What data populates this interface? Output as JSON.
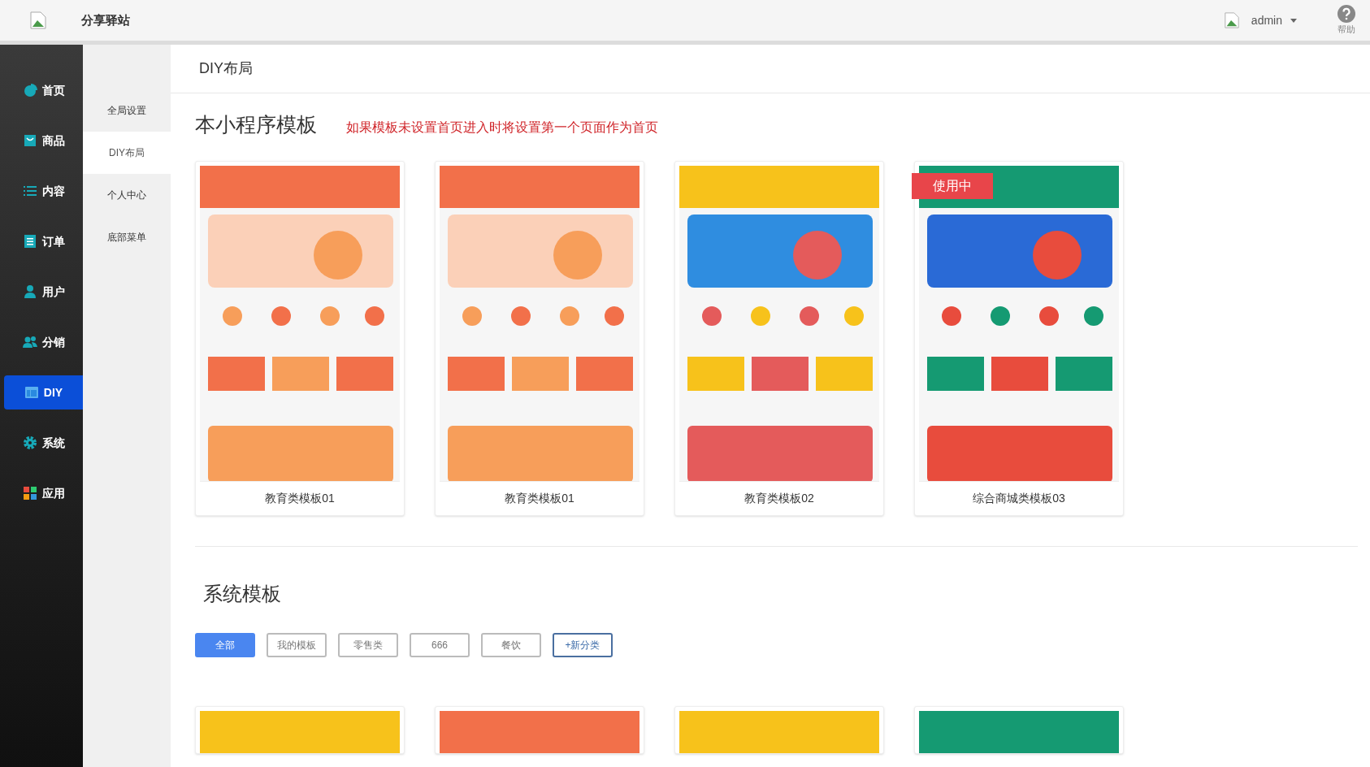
{
  "header": {
    "site_name": "分享驿站",
    "user": "admin",
    "help": "帮助"
  },
  "nav": [
    {
      "label": "首页",
      "selected": false
    },
    {
      "label": "商品",
      "selected": false
    },
    {
      "label": "内容",
      "selected": false
    },
    {
      "label": "订单",
      "selected": false
    },
    {
      "label": "用户",
      "selected": false
    },
    {
      "label": "分销",
      "selected": false
    },
    {
      "label": "DIY",
      "selected": true
    },
    {
      "label": "系统",
      "selected": false
    },
    {
      "label": "应用",
      "selected": false
    }
  ],
  "subnav": [
    {
      "label": "全局设置",
      "selected": false
    },
    {
      "label": "DIY布局",
      "selected": true
    },
    {
      "label": "个人中心",
      "selected": false
    },
    {
      "label": "底部菜单",
      "selected": false
    }
  ],
  "page_title": "DIY布局",
  "my_templates": {
    "title": "本小程序模板",
    "notice": "如果模板未设置首页进入时将设置第一个页面作为首页",
    "items": [
      {
        "caption": "教育类模板01"
      },
      {
        "caption": "教育类模板01"
      },
      {
        "caption": "教育类模板02"
      },
      {
        "caption": "综合商城类模板03",
        "badge": "使用中"
      }
    ]
  },
  "system_templates": {
    "title": "系统模板",
    "filters": [
      {
        "label": "全部",
        "kind": "category",
        "selected": true
      },
      {
        "label": "我的模板",
        "kind": "category",
        "selected": false
      },
      {
        "label": "零售类",
        "kind": "category",
        "selected": false
      },
      {
        "label": "666",
        "kind": "category",
        "selected": false
      },
      {
        "label": "餐饮",
        "kind": "category",
        "selected": false
      },
      {
        "label": "+新分类",
        "kind": "add",
        "selected": false
      }
    ]
  }
}
